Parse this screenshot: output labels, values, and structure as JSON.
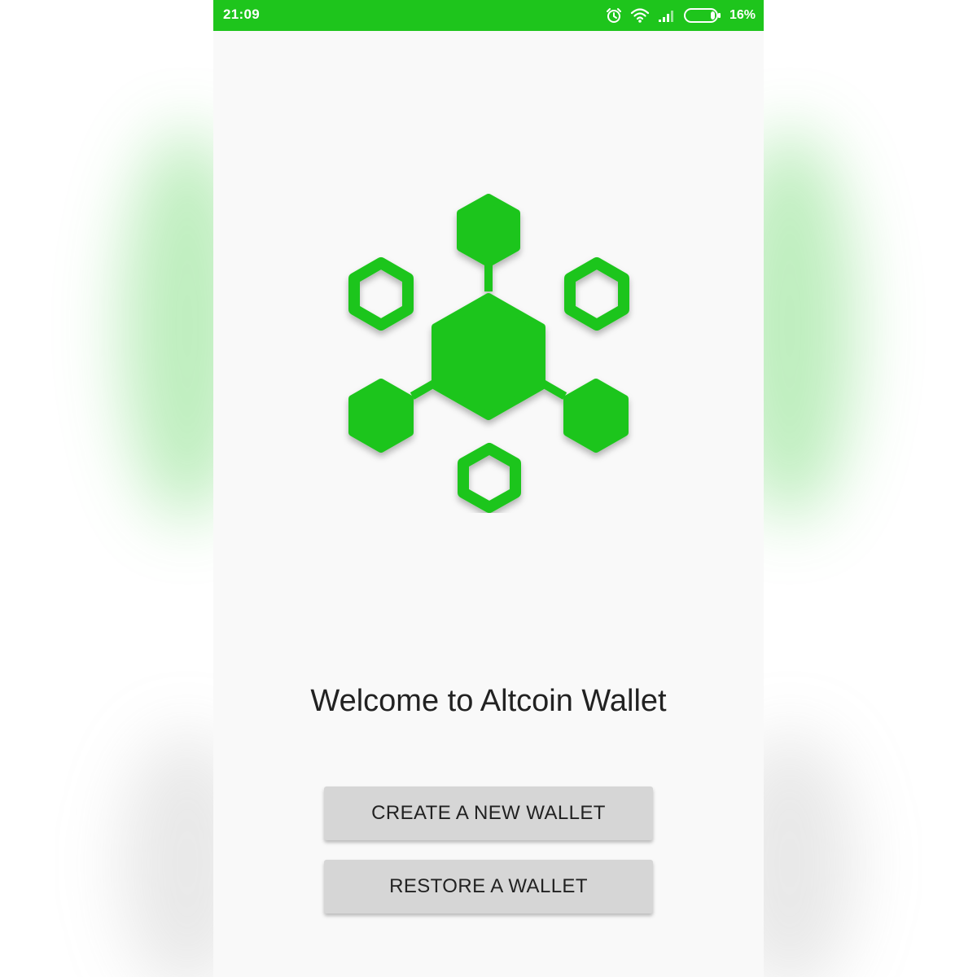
{
  "status_bar": {
    "time": "21:09",
    "battery": "16%",
    "icons": [
      "alarm-icon",
      "wifi-icon",
      "signal-icon",
      "battery-icon"
    ],
    "color": "#1ec51c"
  },
  "logo": {
    "icon": "hexagon-network-logo-icon",
    "color": "#1ec51c"
  },
  "welcome": {
    "title": "Welcome to Altcoin Wallet"
  },
  "actions": {
    "create_label": "CREATE A NEW WALLET",
    "restore_label": "RESTORE A WALLET"
  }
}
